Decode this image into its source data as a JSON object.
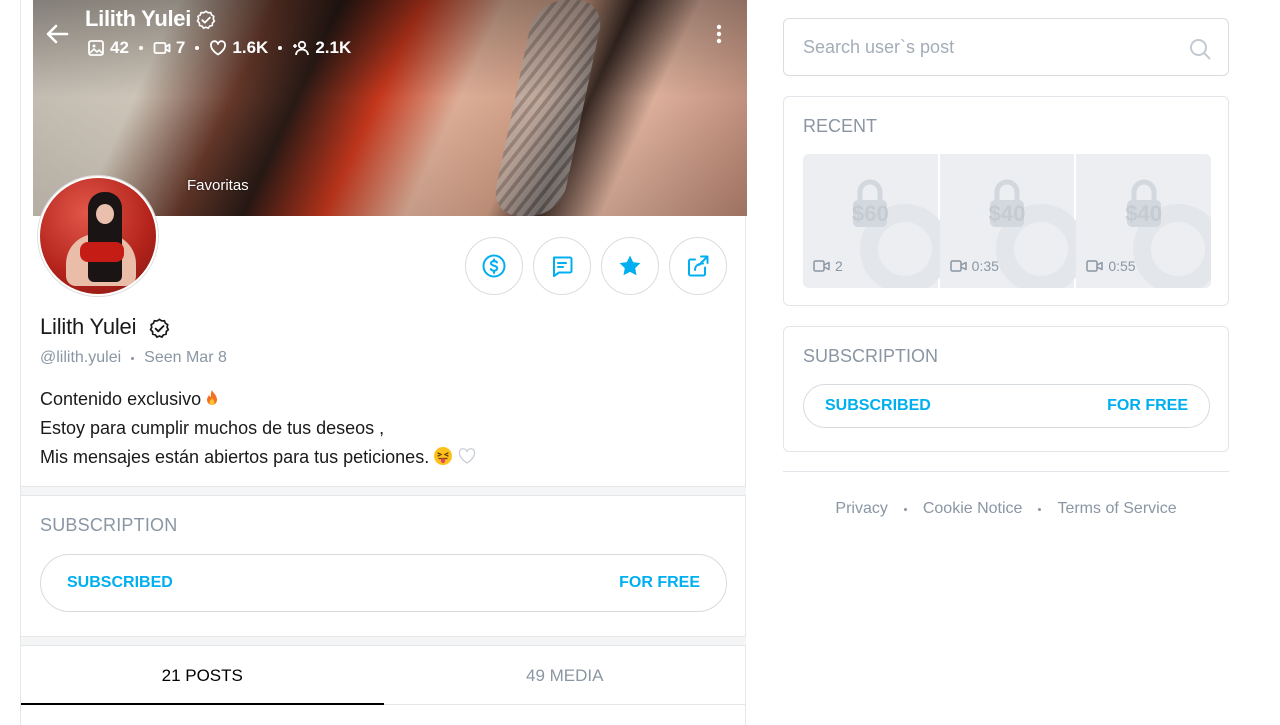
{
  "profile": {
    "name": "Lilith Yulei",
    "handle": "@lilith.yulei",
    "seen": "Seen  Mar 8",
    "cover_label": "Favoritas",
    "stats": {
      "photos": "42",
      "videos": "7",
      "likes": "1.6K",
      "fans": "2.1K"
    },
    "bio": [
      "Contenido exclusivo",
      "Estoy para cumplir muchos de tus deseos ,",
      "Mis mensajes están abiertos para tus peticiones."
    ]
  },
  "subscription": {
    "title": "SUBSCRIPTION",
    "status_label": "SUBSCRIBED",
    "price_label": "FOR FREE"
  },
  "tabs": [
    {
      "label": "21 POSTS",
      "active": true
    },
    {
      "label": "49 MEDIA",
      "active": false
    }
  ],
  "sidebar": {
    "search_placeholder": "Search user`s post",
    "recent_title": "RECENT",
    "recent": [
      {
        "price": "$60",
        "meta": "2"
      },
      {
        "price": "$40",
        "meta": "0:35"
      },
      {
        "price": "$40",
        "meta": "0:55"
      }
    ],
    "subscription_title": "SUBSCRIPTION",
    "subscription_status": "SUBSCRIBED",
    "subscription_price": "FOR FREE",
    "footer": {
      "privacy": "Privacy",
      "cookie": "Cookie Notice",
      "terms": "Terms of Service"
    }
  },
  "colors": {
    "accent": "#00aff0",
    "muted": "#8a96a3",
    "border": "#e2e5e9"
  }
}
